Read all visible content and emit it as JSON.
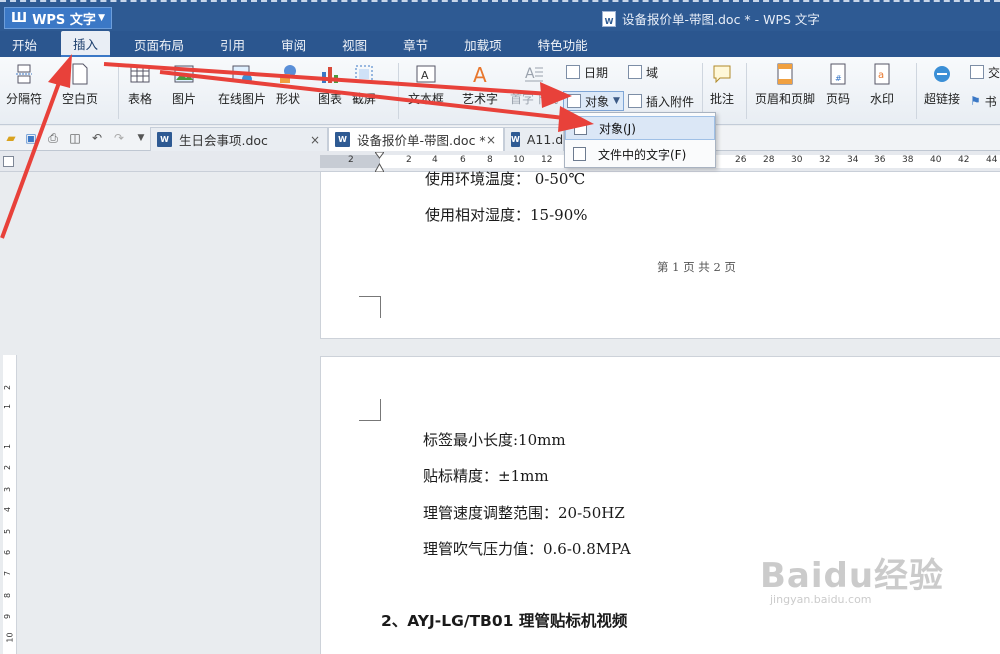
{
  "window": {
    "app_button": "WPS 文字",
    "doc_title": "设备报价单-带图.doc * - WPS 文字"
  },
  "ribbon_tabs": [
    "开始",
    "插入",
    "页面布局",
    "引用",
    "审阅",
    "视图",
    "章节",
    "加载项",
    "特色功能"
  ],
  "ribbon": {
    "break": "分隔符",
    "blank_page": "空白页",
    "table": "表格",
    "picture": "图片",
    "online_picture": "在线图片",
    "shapes": "形状",
    "chart": "图表",
    "screenshot": "截屏",
    "textbox": "文本框",
    "wordart": "艺术字",
    "symbol": "首字下沉",
    "date": "日期",
    "field": "域",
    "object": "对象",
    "insert_attachment": "插入附件",
    "comment": "批注",
    "header_footer": "页眉和页脚",
    "page_number": "页码",
    "watermark": "水印",
    "hyperlink": "超链接",
    "cross_ref": "交",
    "bookmark": "书"
  },
  "doc_tabs": [
    {
      "label": "生日会事项.doc",
      "close": "×"
    },
    {
      "label": "设备报价单-带图.doc *",
      "close": "×"
    },
    {
      "label": "A11.doc"
    }
  ],
  "ruler_marks": [
    "2",
    "2",
    "4",
    "6",
    "8",
    "10",
    "12",
    "26",
    "28",
    "30",
    "32",
    "34",
    "36",
    "38",
    "40",
    "42",
    "44"
  ],
  "vruler_marks": [
    "2",
    "1",
    "1",
    "2",
    "3",
    "4",
    "5",
    "6",
    "7",
    "8",
    "9",
    "10"
  ],
  "dropdown": {
    "items": [
      "对象(J)",
      "文件中的文字(F)"
    ]
  },
  "page1": {
    "line_partial": "使用环境温度： 0-50℃",
    "line2": "使用相对湿度：15-90%",
    "footer": "第 1 页 共 2 页"
  },
  "page2": {
    "lines": [
      "标签最小长度:10mm",
      "贴标精度：±1mm",
      "理管速度调整范围：20-50HZ",
      "理管吹气压力值：0.6-0.8MPA"
    ],
    "heading": "2、AYJ-LG/TB01 理管贴标机视频"
  },
  "watermark": {
    "brand": "Baidu经验",
    "url": "jingyan.baidu.com"
  },
  "colors": {
    "title_bar": "#2e5a93",
    "accent": "#3b78c6",
    "arrow": "#e8413a"
  }
}
